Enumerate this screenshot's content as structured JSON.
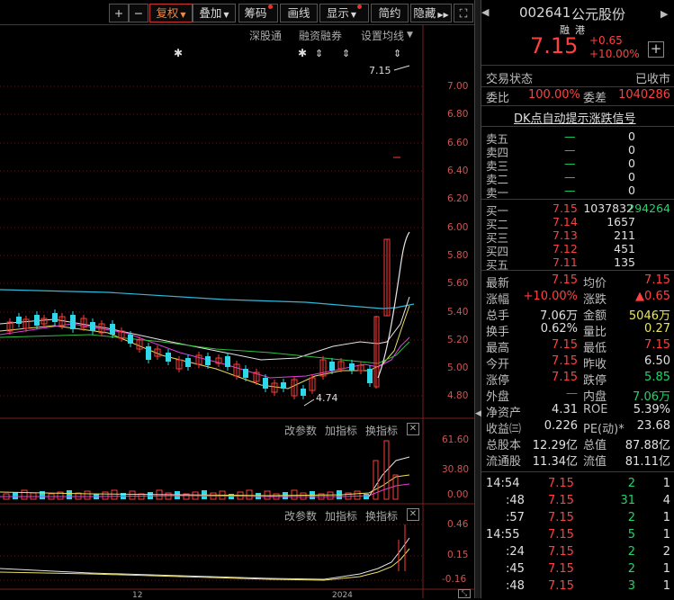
{
  "toolbar": {
    "plus": "+",
    "minus": "−",
    "fuquan": "复权",
    "diejia": "叠加",
    "chouma": "筹码",
    "huaxian": "画线",
    "xianshi": "显示",
    "jianyue": "简约",
    "yincang": "隐藏"
  },
  "subbar": {
    "shengutong": "深股通",
    "rongzi": "融资融券",
    "shezhi": "设置均线"
  },
  "price_axis": [
    "7.00",
    "6.80",
    "6.60",
    "6.40",
    "6.20",
    "6.00",
    "5.80",
    "5.60",
    "5.40",
    "5.20",
    "5.00",
    "4.80"
  ],
  "annotations": {
    "high": "7.15",
    "low": "4.74"
  },
  "vol_panel": {
    "btn1": "改参数",
    "btn2": "加指标",
    "btn3": "换指标",
    "axis": [
      "61.60",
      "30.80",
      "0.00"
    ]
  },
  "ind_panel": {
    "btn1": "改参数",
    "btn2": "加指标",
    "btn3": "换指标",
    "axis": [
      "0.46",
      "0.15",
      "-0.16"
    ]
  },
  "x_labels": [
    "12",
    "2024"
  ],
  "quote": {
    "code": "002641",
    "name": "公元股份",
    "tag1": "融",
    "tag2": "港",
    "price": "7.15",
    "change": "+0.65",
    "pct": "+10.00%",
    "status_label": "交易状态",
    "status_value": "已收市",
    "weibi_label": "委比",
    "weibi_value": "100.00%",
    "weicha_label": "委差",
    "weicha_value": "1040286",
    "dk_link": "DK点自动提示涨跌信号"
  },
  "sells": [
    {
      "label": "卖五",
      "price": "—",
      "vol": "0"
    },
    {
      "label": "卖四",
      "price": "—",
      "vol": "0"
    },
    {
      "label": "卖三",
      "price": "—",
      "vol": "0"
    },
    {
      "label": "卖二",
      "price": "—",
      "vol": "0"
    },
    {
      "label": "卖一",
      "price": "—",
      "vol": "0"
    }
  ],
  "buys": [
    {
      "label": "买一",
      "price": "7.15",
      "vol": "1037832",
      "extra": "294264"
    },
    {
      "label": "买二",
      "price": "7.14",
      "vol": "1657",
      "extra": ""
    },
    {
      "label": "买三",
      "price": "7.13",
      "vol": "211",
      "extra": ""
    },
    {
      "label": "买四",
      "price": "7.12",
      "vol": "451",
      "extra": ""
    },
    {
      "label": "买五",
      "price": "7.11",
      "vol": "135",
      "extra": ""
    }
  ],
  "stats": [
    {
      "l1": "最新",
      "v1": "7.15",
      "c1": "red",
      "l2": "均价",
      "v2": "7.15",
      "c2": "red"
    },
    {
      "l1": "涨幅",
      "v1": "+10.00%",
      "c1": "red",
      "l2": "涨跌",
      "v2": "▲0.65",
      "c2": "red"
    },
    {
      "l1": "总手",
      "v1": "7.06万",
      "c1": "white",
      "l2": "金额",
      "v2": "5046万",
      "c2": "yellow"
    },
    {
      "l1": "换手",
      "v1": "0.62%",
      "c1": "white",
      "l2": "量比",
      "v2": "0.27",
      "c2": "yellow"
    },
    {
      "l1": "最高",
      "v1": "7.15",
      "c1": "red",
      "l2": "最低",
      "v2": "7.15",
      "c2": "red"
    },
    {
      "l1": "今开",
      "v1": "7.15",
      "c1": "red",
      "l2": "昨收",
      "v2": "6.50",
      "c2": "white"
    },
    {
      "l1": "涨停",
      "v1": "7.15",
      "c1": "red",
      "l2": "跌停",
      "v2": "5.85",
      "c2": "green"
    },
    {
      "l1": "外盘",
      "v1": "—",
      "c1": "red",
      "l2": "内盘",
      "v2": "7.06万",
      "c2": "green"
    },
    {
      "l1": "净资产",
      "v1": "4.31",
      "c1": "white",
      "l2": "ROE",
      "v2": "5.39%",
      "c2": "white"
    },
    {
      "l1": "收益㈢",
      "v1": "0.226",
      "c1": "white",
      "l2": "PE(动)*",
      "v2": "23.68",
      "c2": "white"
    },
    {
      "l1": "总股本",
      "v1": "12.29亿",
      "c1": "white",
      "l2": "总值",
      "v2": "87.88亿",
      "c2": "white"
    },
    {
      "l1": "流通股",
      "v1": "11.34亿",
      "c1": "white",
      "l2": "流值",
      "v2": "81.11亿",
      "c2": "white"
    }
  ],
  "ticks": [
    {
      "time": "14:54",
      "price": "7.15",
      "vol": "2",
      "n": "1"
    },
    {
      "time": ":48",
      "price": "7.15",
      "vol": "31",
      "n": "4"
    },
    {
      "time": ":57",
      "price": "7.15",
      "vol": "2",
      "n": "1"
    },
    {
      "time": "14:55",
      "price": "7.15",
      "vol": "5",
      "n": "1"
    },
    {
      "time": ":24",
      "price": "7.15",
      "vol": "2",
      "n": "2"
    },
    {
      "time": ":45",
      "price": "7.15",
      "vol": "2",
      "n": "1"
    },
    {
      "time": ":48",
      "price": "7.15",
      "vol": "3",
      "n": "1"
    }
  ]
}
